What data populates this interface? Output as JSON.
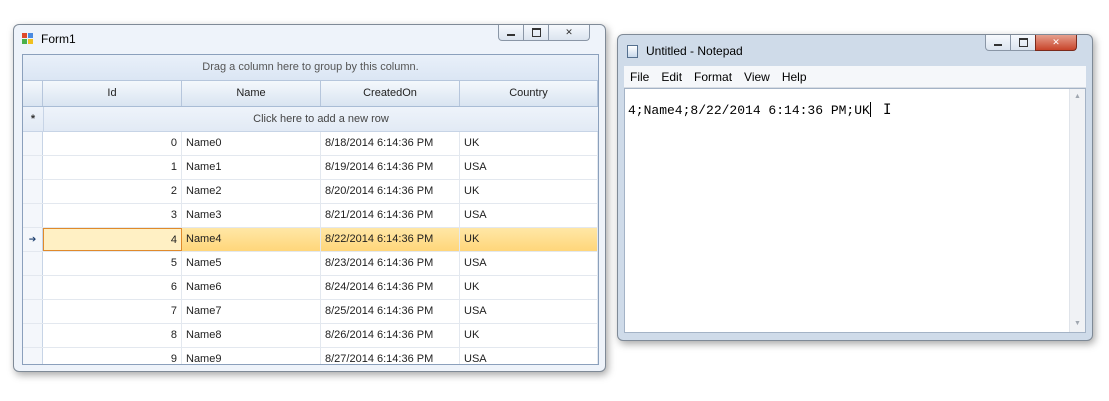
{
  "form1": {
    "title": "Form1",
    "group_panel_text": "Drag a column here to group by this column.",
    "columns": [
      "Id",
      "Name",
      "CreatedOn",
      "Country"
    ],
    "new_row_text": "Click here to add a new row",
    "new_row_glyph": "*",
    "selected_indicator": "➔",
    "rows": [
      {
        "id": "0",
        "name": "Name0",
        "created": "8/18/2014 6:14:36 PM",
        "country": "UK"
      },
      {
        "id": "1",
        "name": "Name1",
        "created": "8/19/2014 6:14:36 PM",
        "country": "USA"
      },
      {
        "id": "2",
        "name": "Name2",
        "created": "8/20/2014 6:14:36 PM",
        "country": "UK"
      },
      {
        "id": "3",
        "name": "Name3",
        "created": "8/21/2014 6:14:36 PM",
        "country": "USA"
      },
      {
        "id": "4",
        "name": "Name4",
        "created": "8/22/2014 6:14:36 PM",
        "country": "UK"
      },
      {
        "id": "5",
        "name": "Name5",
        "created": "8/23/2014 6:14:36 PM",
        "country": "USA"
      },
      {
        "id": "6",
        "name": "Name6",
        "created": "8/24/2014 6:14:36 PM",
        "country": "UK"
      },
      {
        "id": "7",
        "name": "Name7",
        "created": "8/25/2014 6:14:36 PM",
        "country": "USA"
      },
      {
        "id": "8",
        "name": "Name8",
        "created": "8/26/2014 6:14:36 PM",
        "country": "UK"
      },
      {
        "id": "9",
        "name": "Name9",
        "created": "8/27/2014 6:14:36 PM",
        "country": "USA"
      }
    ]
  },
  "notepad": {
    "title": "Untitled - Notepad",
    "menu": [
      "File",
      "Edit",
      "Format",
      "View",
      "Help"
    ],
    "content": "4;Name4;8/22/2014 6:14:36 PM;UK"
  },
  "colors": {
    "selection_fill": "#ffd67a",
    "selection_border": "#e08a2b",
    "close_button_red": "#c8442a"
  }
}
